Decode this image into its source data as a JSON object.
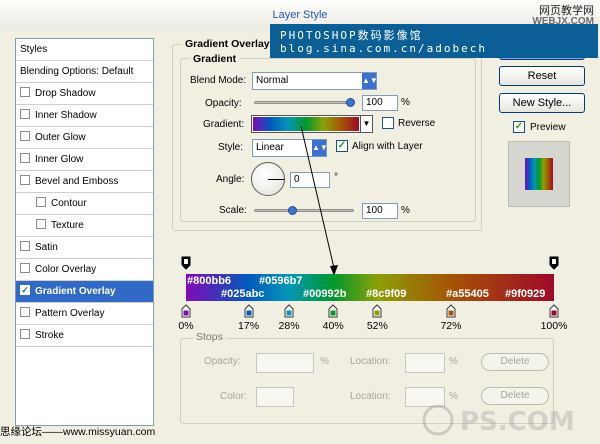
{
  "window": {
    "title": "Layer Style"
  },
  "watermark": {
    "site_cn": "网页教学网",
    "site_url": "WEBJX.COM",
    "banner_line1": "PHOTOSHOP数码影像馆",
    "banner_line2": "blog.sina.com.cn/adobech",
    "bottom_left": "思缘论坛——www.missyuan.com",
    "bottom_right_logo": "PS.COM"
  },
  "sidebar": {
    "items": [
      {
        "label": "Styles",
        "check": false,
        "kind": "header"
      },
      {
        "label": "Blending Options: Default",
        "check": false,
        "kind": "header"
      },
      {
        "label": "Drop Shadow",
        "check": false
      },
      {
        "label": "Inner Shadow",
        "check": false
      },
      {
        "label": "Outer Glow",
        "check": false
      },
      {
        "label": "Inner Glow",
        "check": false
      },
      {
        "label": "Bevel and Emboss",
        "check": false
      },
      {
        "label": "Contour",
        "check": false,
        "indent": true
      },
      {
        "label": "Texture",
        "check": false,
        "indent": true
      },
      {
        "label": "Satin",
        "check": false
      },
      {
        "label": "Color Overlay",
        "check": false
      },
      {
        "label": "Gradient Overlay",
        "check": true,
        "selected": true
      },
      {
        "label": "Pattern Overlay",
        "check": false
      },
      {
        "label": "Stroke",
        "check": false
      }
    ]
  },
  "panel": {
    "title": "Gradient Overlay",
    "section": "Gradient",
    "blend_mode_label": "Blend Mode:",
    "blend_mode_value": "Normal",
    "opacity_label": "Opacity:",
    "opacity_value": "100",
    "opacity_unit": "%",
    "opacity_level": 1.0,
    "gradient_label": "Gradient:",
    "reverse_label": "Reverse",
    "reverse_checked": false,
    "style_label": "Style:",
    "style_value": "Linear",
    "align_label": "Align with Layer",
    "align_checked": true,
    "angle_label": "Angle:",
    "angle_value": "0",
    "angle_unit": "°",
    "scale_label": "Scale:",
    "scale_value": "100",
    "scale_unit": "%",
    "scale_level": 0.4
  },
  "buttons": {
    "ok": "OK",
    "reset": "Reset",
    "new_style": "New Style...",
    "preview_label": "Preview",
    "preview_checked": true
  },
  "gradient_editor": {
    "stops": [
      {
        "color": "#800bb6",
        "label": "#800bb6",
        "location": "0%"
      },
      {
        "color": "#025abc",
        "label": "#025abc",
        "location": "17%"
      },
      {
        "color": "#0596b7",
        "label": "#0596b7",
        "location": "28%"
      },
      {
        "color": "#00992b",
        "label": "#00992b",
        "location": "40%"
      },
      {
        "color": "#8c9f09",
        "label": "#8c9f09",
        "location": "52%"
      },
      {
        "color": "#a55405",
        "label": "#a55405",
        "location": "72%"
      },
      {
        "color": "#9f0929",
        "label": "#9f0929",
        "location": "100%"
      }
    ],
    "stops_section": "Stops",
    "opacity_label": "Opacity:",
    "color_label": "Color:",
    "location_label": "Location:",
    "pct": "%",
    "delete_label": "Delete"
  }
}
